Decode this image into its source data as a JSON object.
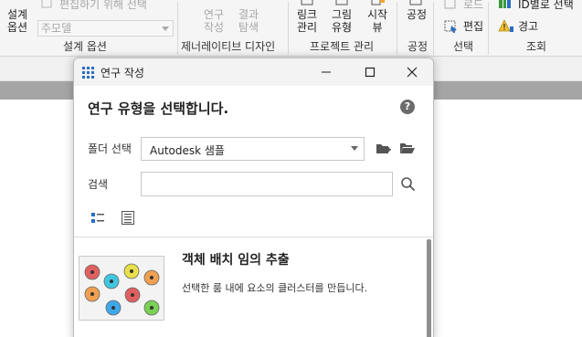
{
  "ribbon": {
    "design_options": {
      "line1": "설계",
      "line2": "옵션"
    },
    "edit_link": "편집하기 위해 선택",
    "main_model": "주모델",
    "group_design_options": "설계 옵션",
    "study": {
      "line1": "연구",
      "line2": "작성"
    },
    "results": {
      "line1": "결과",
      "line2": "탐색"
    },
    "group_generative": "제너레이티브 디자인",
    "manage_links": {
      "line1": "링크",
      "line2": "관리"
    },
    "view_types": {
      "line1": "그림",
      "line2": "유형"
    },
    "starting_view": {
      "line1": "시작",
      "line2": "뷰"
    },
    "group_project_manage": "프로젝트 관리",
    "process": "공정",
    "group_process": "공정",
    "load": "로드",
    "edit": "편집",
    "group_selection": "선택",
    "select_by_id": "ID별로 선택",
    "warnings": "경고",
    "group_inquiry": "조회"
  },
  "dialog": {
    "title": "연구 작성",
    "heading": "연구 유형을 선택합니다.",
    "help_glyph": "?",
    "folder_label": "폴더 선택",
    "folder_value": "Autodesk 샘플",
    "search_label": "검색",
    "search_value": "",
    "item": {
      "title": "객체 배치 임의 추출",
      "description": "선택한 룸 내에 요소의 클러스터를 만듭니다."
    }
  },
  "colors": {
    "circle_red": "#e06060",
    "circle_cyan": "#41c6e0",
    "circle_yellow": "#e8e04a",
    "circle_orange": "#f0a050",
    "circle_blue": "#3ea8ea",
    "circle_green": "#7bd155",
    "accent_blue": "#2b6cc4"
  },
  "icons": [
    "grid-icon",
    "minimize-icon",
    "maximize-icon",
    "close-icon",
    "help-icon",
    "new-folder-icon",
    "open-folder-icon",
    "search-icon",
    "tile-view-icon",
    "list-view-icon"
  ]
}
